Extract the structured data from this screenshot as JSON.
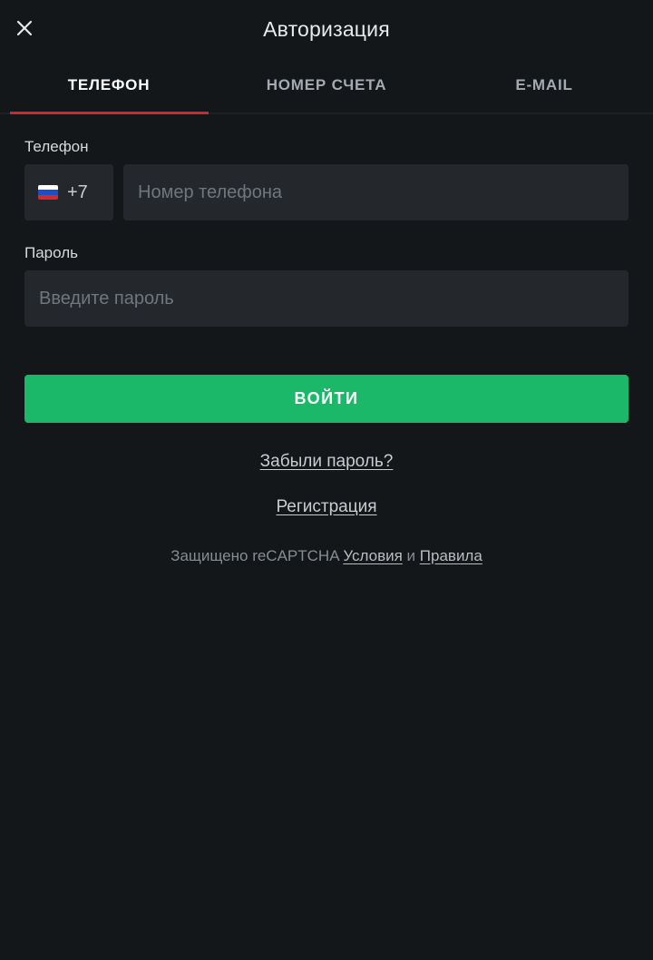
{
  "header": {
    "title": "Авторизация",
    "close_icon": "close-icon"
  },
  "tabs": [
    {
      "label": "ТЕЛЕФОН",
      "active": true
    },
    {
      "label": "НОМЕР СЧЕТА",
      "active": false
    },
    {
      "label": "E-MAIL",
      "active": false
    }
  ],
  "phone": {
    "label": "Телефон",
    "country_flag": "russia-flag-icon",
    "country_code": "+7",
    "placeholder": "Номер телефона",
    "value": ""
  },
  "password": {
    "label": "Пароль",
    "placeholder": "Введите пароль",
    "value": ""
  },
  "login_button": {
    "label": "ВОЙТИ",
    "color": "#1cb86a"
  },
  "forgot_link": "Забыли пароль?",
  "register_link": "Регистрация",
  "recaptcha": {
    "prefix": "Защищено reCAPTCHA",
    "terms": "Условия",
    "and": "и",
    "privacy": "Правила"
  },
  "colors": {
    "background": "#13171a",
    "field_bg": "#24282d",
    "tab_underline": "#d8232a",
    "accent_green": "#1cb86a"
  }
}
